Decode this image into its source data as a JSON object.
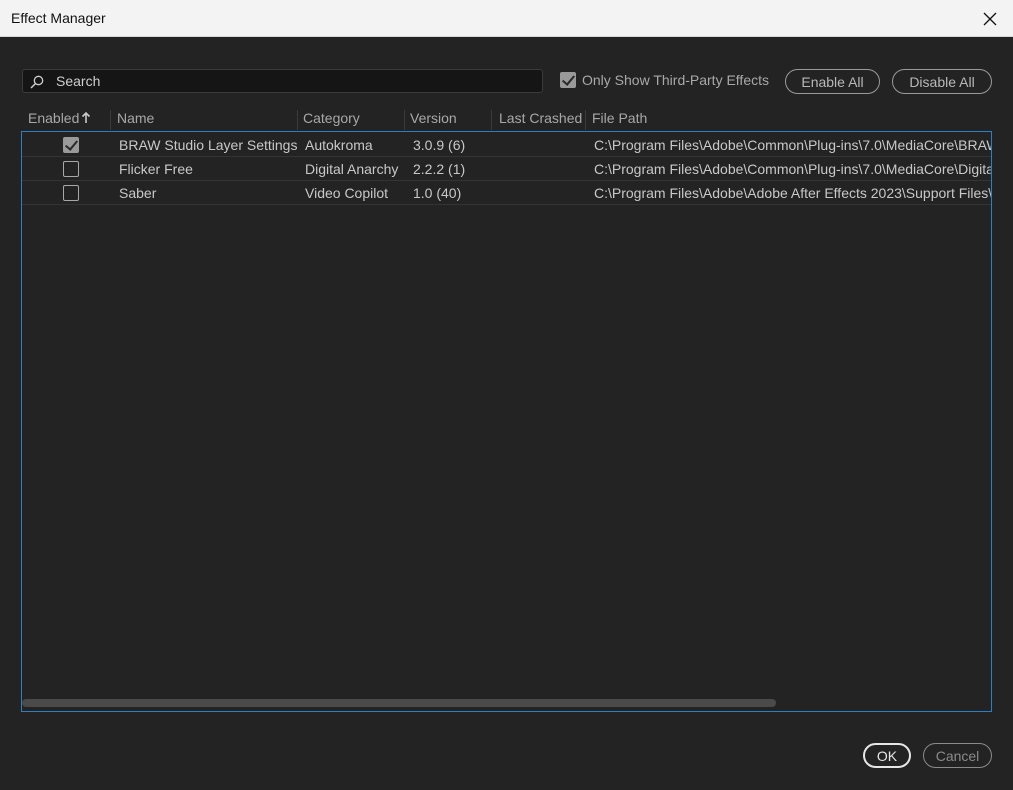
{
  "window": {
    "title": "Effect Manager"
  },
  "search": {
    "placeholder": "Search",
    "value": ""
  },
  "filter": {
    "third_party_label": "Only Show Third-Party Effects",
    "third_party_checked": true
  },
  "actions": {
    "enable_all": "Enable All",
    "disable_all": "Disable All"
  },
  "columns": {
    "enabled": "Enabled",
    "name": "Name",
    "category": "Category",
    "version": "Version",
    "last_crashed": "Last Crashed",
    "file_path": "File Path"
  },
  "sort": {
    "column": "enabled",
    "direction": "ascending",
    "icon": "arrow-up-icon"
  },
  "rows": [
    {
      "enabled": true,
      "name": "BRAW Studio Layer Settings",
      "category": "Autokroma",
      "version": "3.0.9 (6)",
      "last_crashed": "",
      "path": "C:\\Program Files\\Adobe\\Common\\Plug-ins\\7.0\\MediaCore\\BRAW"
    },
    {
      "enabled": false,
      "name": "Flicker Free",
      "category": "Digital Anarchy",
      "version": "2.2.2 (1)",
      "last_crashed": "",
      "path": "C:\\Program Files\\Adobe\\Common\\Plug-ins\\7.0\\MediaCore\\Digita"
    },
    {
      "enabled": false,
      "name": "Saber",
      "category": "Video Copilot",
      "version": "1.0 (40)",
      "last_crashed": "",
      "path": "C:\\Program Files\\Adobe\\Adobe After Effects 2023\\Support Files\\"
    }
  ],
  "footer": {
    "ok": "OK",
    "cancel": "Cancel"
  },
  "colors": {
    "accent": "#2d7fc1",
    "background": "#232323",
    "titlebar": "#f3f3f3"
  }
}
